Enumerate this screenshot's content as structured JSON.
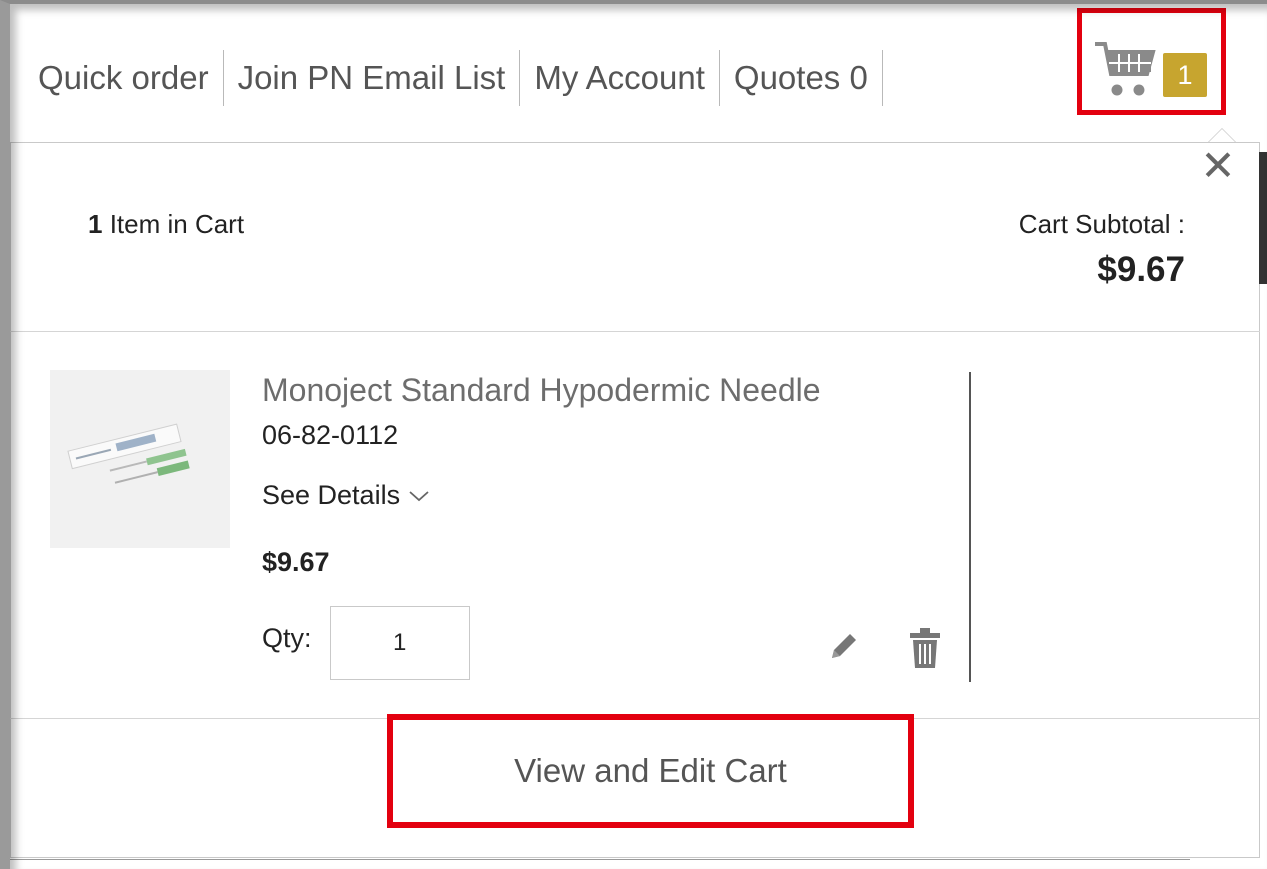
{
  "header": {
    "links": [
      {
        "label": "Quick order"
      },
      {
        "label": "Join PN Email List"
      },
      {
        "label": "My Account"
      },
      {
        "label": "Quotes 0"
      }
    ],
    "cart_count": "1"
  },
  "minicart": {
    "item_count": "1",
    "item_count_suffix": " Item in Cart",
    "subtotal_label": "Cart Subtotal :",
    "subtotal_value": "$9.67",
    "close_icon": "close-icon",
    "item": {
      "name": "Monoject Standard Hypodermic Needle",
      "sku": "06-82-0112",
      "details_label": "See Details",
      "price": "$9.67",
      "qty_label": "Qty:",
      "qty_value": "1"
    },
    "view_cart_label": "View and Edit Cart"
  },
  "colors": {
    "accent_badge": "#c7a52f",
    "highlight": "#e3000f",
    "link_text": "#555555"
  }
}
